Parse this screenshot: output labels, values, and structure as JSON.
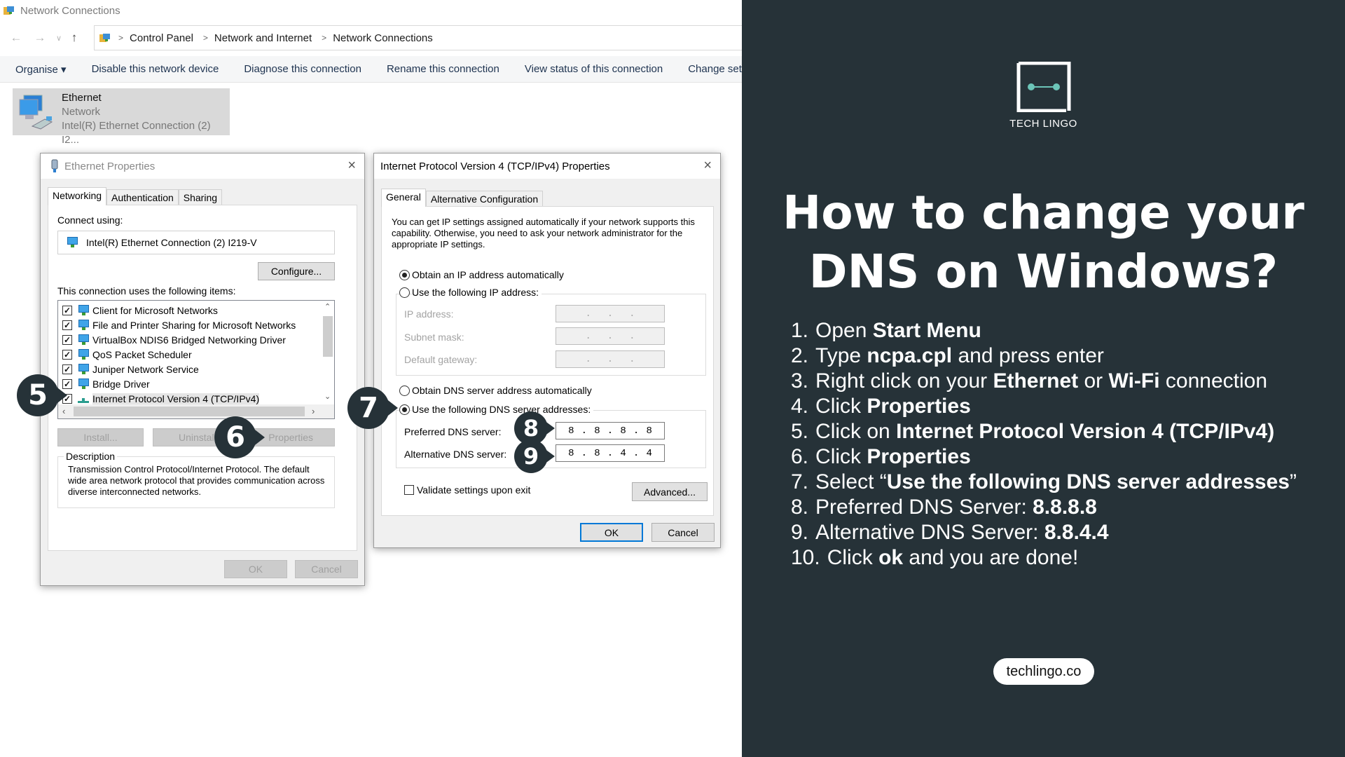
{
  "window": {
    "title": "Network Connections"
  },
  "address_bar": {
    "crumbs": [
      "Control Panel",
      "Network and Internet",
      "Network Connections"
    ]
  },
  "toolbar": {
    "items": [
      "Organise ▾",
      "Disable this network device",
      "Diagnose this connection",
      "Rename this connection",
      "View status of this connection",
      "Change settin"
    ]
  },
  "connection": {
    "name": "Ethernet",
    "status": "Network",
    "adapter": "Intel(R) Ethernet Connection (2) I2..."
  },
  "ethernet_dialog": {
    "title": "Ethernet Properties",
    "close_icon": "×",
    "tabs": [
      "Networking",
      "Authentication",
      "Sharing"
    ],
    "connect_using_label": "Connect using:",
    "adapter": "Intel(R) Ethernet Connection (2) I219-V",
    "configure_button": "Configure...",
    "items_label": "This connection uses the following items:",
    "items": [
      {
        "label": "Client for Microsoft Networks",
        "checked": true
      },
      {
        "label": "File and Printer Sharing for Microsoft Networks",
        "checked": true
      },
      {
        "label": "VirtualBox NDIS6 Bridged Networking Driver",
        "checked": true
      },
      {
        "label": "QoS Packet Scheduler",
        "checked": true
      },
      {
        "label": "Juniper Network Service",
        "checked": true
      },
      {
        "label": "Bridge Driver",
        "checked": true
      },
      {
        "label": "Internet Protocol Version 4 (TCP/IPv4)",
        "checked": true,
        "selected": true
      }
    ],
    "install_button": "Install...",
    "uninstall_button": "Uninstall",
    "properties_button": "Properties",
    "description_label": "Description",
    "description_text": "Transmission Control Protocol/Internet Protocol. The default wide area network protocol that provides communication across diverse interconnected networks.",
    "ok_button": "OK",
    "cancel_button": "Cancel"
  },
  "ipv4_dialog": {
    "title": "Internet Protocol Version 4 (TCP/IPv4) Properties",
    "close_icon": "×",
    "tabs": [
      "General",
      "Alternative Configuration"
    ],
    "intro": "You can get IP settings assigned automatically if your network supports this capability. Otherwise, you need to ask your network administrator for the appropriate IP settings.",
    "ip_auto": "Obtain an IP address automatically",
    "ip_manual": "Use the following IP address:",
    "ip_address_label": "IP address:",
    "subnet_label": "Subnet mask:",
    "gateway_label": "Default gateway:",
    "empty_ip": [
      ".",
      ".",
      "."
    ],
    "dns_auto": "Obtain DNS server address automatically",
    "dns_manual": "Use the following DNS server addresses:",
    "preferred_label": "Preferred DNS server:",
    "preferred_octets": [
      "8",
      ".",
      "8",
      ".",
      "8",
      ".",
      "8"
    ],
    "alternative_label": "Alternative DNS server:",
    "alternative_octets": [
      "8",
      ".",
      "8",
      ".",
      "4",
      ".",
      "4"
    ],
    "validate_label": "Validate settings upon exit",
    "validate_checked": false,
    "advanced_button": "Advanced...",
    "ok_button": "OK",
    "cancel_button": "Cancel"
  },
  "badges": [
    "5",
    "6",
    "7",
    "8",
    "9"
  ],
  "panel": {
    "background": "#263238",
    "accent": "#6cc5b8",
    "logo_text": "TECH LINGO",
    "heading_line1": "How to change your",
    "heading_line2": "DNS on Windows?",
    "steps": [
      {
        "n": "1.",
        "parts": [
          {
            "t": "Open ",
            "b": false
          },
          {
            "t": "Start Menu",
            "b": true
          }
        ]
      },
      {
        "n": "2.",
        "parts": [
          {
            "t": "Type ",
            "b": false
          },
          {
            "t": "ncpa.cpl",
            "b": true
          },
          {
            "t": " and press enter",
            "b": false
          }
        ]
      },
      {
        "n": "3.",
        "parts": [
          {
            "t": "Right click on your ",
            "b": false
          },
          {
            "t": "Ethernet",
            "b": true
          },
          {
            "t": " or ",
            "b": false
          },
          {
            "t": "Wi-Fi",
            "b": true
          },
          {
            "t": " connection",
            "b": false
          }
        ]
      },
      {
        "n": "4.",
        "parts": [
          {
            "t": "Click ",
            "b": false
          },
          {
            "t": "Properties",
            "b": true
          }
        ]
      },
      {
        "n": "5.",
        "parts": [
          {
            "t": "Click on ",
            "b": false
          },
          {
            "t": "Internet Protocol Version 4 (TCP/IPv4)",
            "b": true
          }
        ]
      },
      {
        "n": "6.",
        "parts": [
          {
            "t": "Click ",
            "b": false
          },
          {
            "t": "Properties",
            "b": true
          }
        ]
      },
      {
        "n": "7.",
        "parts": [
          {
            "t": "Select “",
            "b": false
          },
          {
            "t": "Use the following DNS server addresses",
            "b": true
          },
          {
            "t": "”",
            "b": false
          }
        ]
      },
      {
        "n": "8.",
        "parts": [
          {
            "t": "Preferred DNS Server: ",
            "b": false
          },
          {
            "t": "8.8.8.8",
            "b": true
          }
        ]
      },
      {
        "n": "9.",
        "parts": [
          {
            "t": "Alternative DNS Server: ",
            "b": false
          },
          {
            "t": "8.8.4.4",
            "b": true
          }
        ]
      },
      {
        "n": "10.",
        "parts": [
          {
            "t": "Click ",
            "b": false
          },
          {
            "t": "ok",
            "b": true
          },
          {
            "t": " and you are done!",
            "b": false
          }
        ]
      }
    ],
    "site": "techlingo.co"
  }
}
